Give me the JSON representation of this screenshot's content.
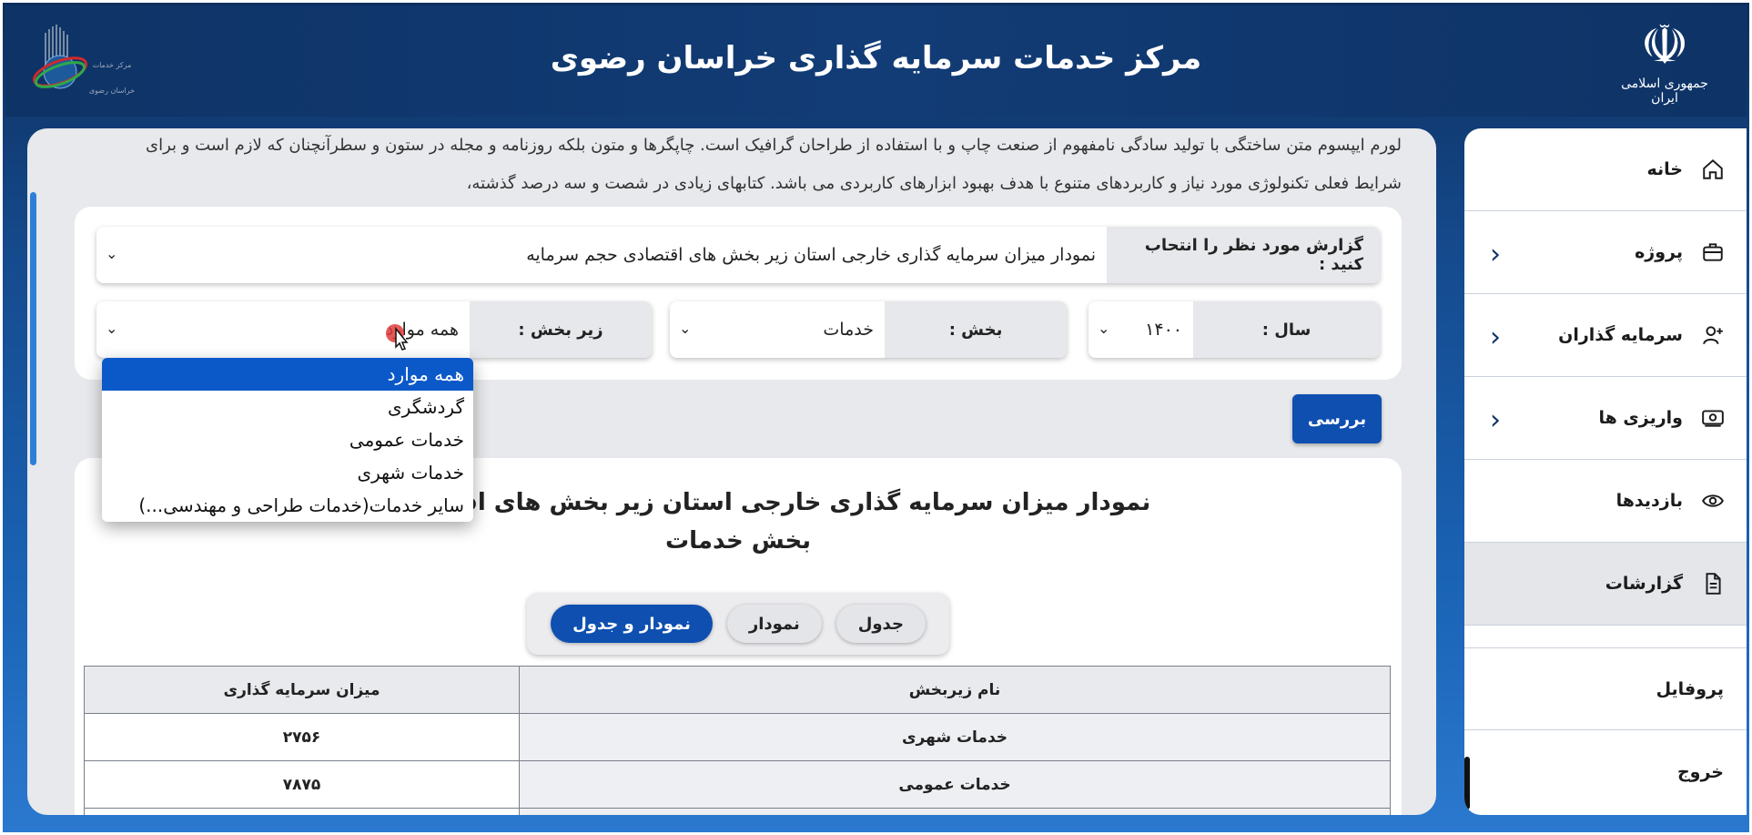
{
  "header": {
    "title": "مرکز خدمات سرمایه گذاری خراسان رضوی",
    "emblem_text": "جمهوری اسلامی ایران",
    "left_logo_text_1": "مرکز خدمات",
    "left_logo_text_2": "خراسان رضوی"
  },
  "sidebar": {
    "items": [
      {
        "label": "خانه",
        "icon": "home-icon"
      },
      {
        "label": "پروژه",
        "icon": "briefcase-icon"
      },
      {
        "label": "سرمایه گذاران",
        "icon": "user-plus-icon"
      },
      {
        "label": "واریزی ها",
        "icon": "money-icon"
      },
      {
        "label": "بازدیدها",
        "icon": "eye-icon"
      },
      {
        "label": "گزارشات",
        "icon": "file-icon"
      },
      {
        "label": "پروفایل"
      },
      {
        "label": "خروج"
      }
    ]
  },
  "intro": {
    "line1": "لورم ایپسوم متن ساختگی با تولید سادگی نامفهوم از صنعت چاپ و با استفاده از طراحان گرافیک است. چاپگرها و متون بلکه روزنامه و مجله در ستون و سطرآنچنان که لازم است و برای",
    "line2": "شرایط فعلی تکنولوژی مورد نیاز و کاربردهای متنوع با هدف بهبود ابزارهای کاربردی می باشد. کتابهای زیادی در شصت و سه درصد گذشته،"
  },
  "filters": {
    "report_label": "گزارش مورد نظر را انتحاب کنید :",
    "report_value": "نمودار میزان سرمایه گذاری خارجی استان زیر بخش های اقتصادی حجم سرمایه",
    "year_label": "سال :",
    "year_value": "۱۴۰۰",
    "sector_label": "بخش :",
    "sector_value": "خدمات",
    "subsector_label": "زیر بخش :",
    "subsector_value": "همه موارد"
  },
  "review_button": "بررسی",
  "chart": {
    "title_line1": "نمودار میزان سرمایه گذاری خارجی استان زیر بخش های اقتصادی حجم",
    "title_line2": "بخش خدمات"
  },
  "view_tabs": [
    "جدول",
    "نمودار",
    "نمودار و جدول"
  ],
  "table": {
    "headers": [
      "نام زیربخش",
      "میزان سرمایه گذاری"
    ],
    "rows": [
      [
        "خدمات شهری",
        "۲۷۵۶"
      ],
      [
        "خدمات عمومی",
        "۷۸۷۵"
      ]
    ]
  },
  "dropdown": {
    "options": [
      "همه موارد",
      "گردشگری",
      "خدمات عمومی",
      "خدمات شهری",
      "سایر خدمات(خدمات طراحی و مهندسی...)"
    ],
    "selected_index": 0
  },
  "colors": {
    "header_bg": "#0e3366",
    "accent": "#0e4fb0",
    "dropdown_selected": "#0b59c9"
  }
}
